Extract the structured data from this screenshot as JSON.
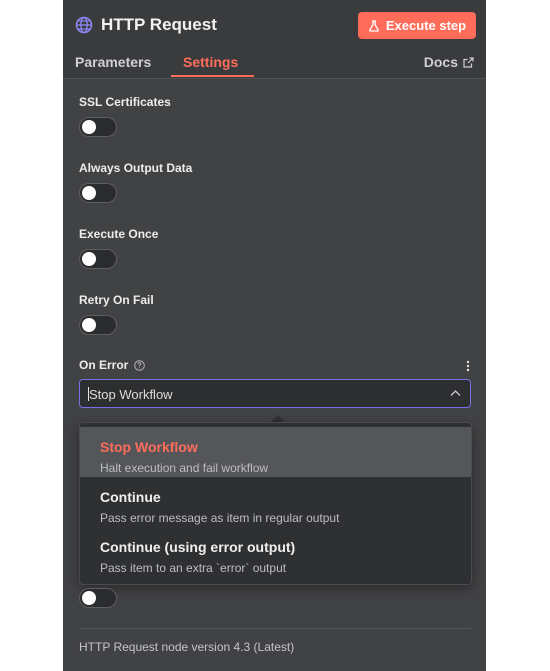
{
  "header": {
    "title": "HTTP Request",
    "execute_button": "Execute step"
  },
  "tabs": [
    {
      "label": "Parameters",
      "active": false
    },
    {
      "label": "Settings",
      "active": true
    }
  ],
  "docs_label": "Docs",
  "settings": [
    {
      "label": "SSL Certificates",
      "enabled": false
    },
    {
      "label": "Always Output Data",
      "enabled": false
    },
    {
      "label": "Execute Once",
      "enabled": false
    },
    {
      "label": "Retry On Fail",
      "enabled": false
    }
  ],
  "on_error": {
    "label": "On Error",
    "value": "Stop Workflow",
    "options": [
      {
        "title": "Stop Workflow",
        "description": "Halt execution and fail workflow",
        "selected": true
      },
      {
        "title": "Continue",
        "description": "Pass error message as item in regular output",
        "selected": false
      },
      {
        "title": "Continue (using error output)",
        "description": "Pass item to an extra `error` output",
        "selected": false
      }
    ]
  },
  "footer": "HTTP Request node version 4.3 (Latest)",
  "colors": {
    "accent": "#ff6d5a",
    "focus": "#7b6ee8",
    "panel": "#414244"
  }
}
